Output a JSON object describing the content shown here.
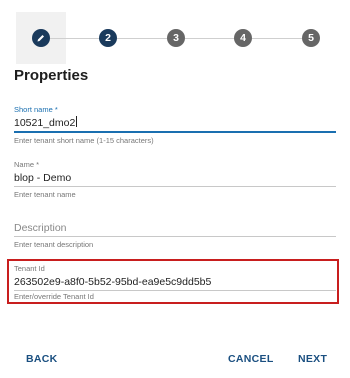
{
  "stepper": {
    "steps": [
      {
        "label": "",
        "icon": "pencil-icon",
        "state": "edit"
      },
      {
        "label": "2",
        "state": "active"
      },
      {
        "label": "3",
        "state": "todo"
      },
      {
        "label": "4",
        "state": "todo"
      },
      {
        "label": "5",
        "state": "todo"
      }
    ]
  },
  "title": "Properties",
  "fields": {
    "short_name": {
      "label": "Short name *",
      "value": "10521_dmo2",
      "help": "Enter tenant short name (1-15 characters)"
    },
    "name": {
      "label": "Name *",
      "value": "blop - Demo",
      "help": "Enter tenant name"
    },
    "description": {
      "placeholder": "Description",
      "help": "Enter tenant description"
    },
    "tenant_id": {
      "label": "Tenant Id",
      "value": "263502e9-a8f0-5b52-95bd-ea9e5c9dd5b5",
      "help": "Enter/override Tenant Id"
    }
  },
  "buttons": {
    "back": "BACK",
    "cancel": "CANCEL",
    "next": "NEXT"
  },
  "colors": {
    "primary": "#1a3a5c",
    "accent": "#1a6fb0",
    "highlight": "#c81e1e"
  }
}
